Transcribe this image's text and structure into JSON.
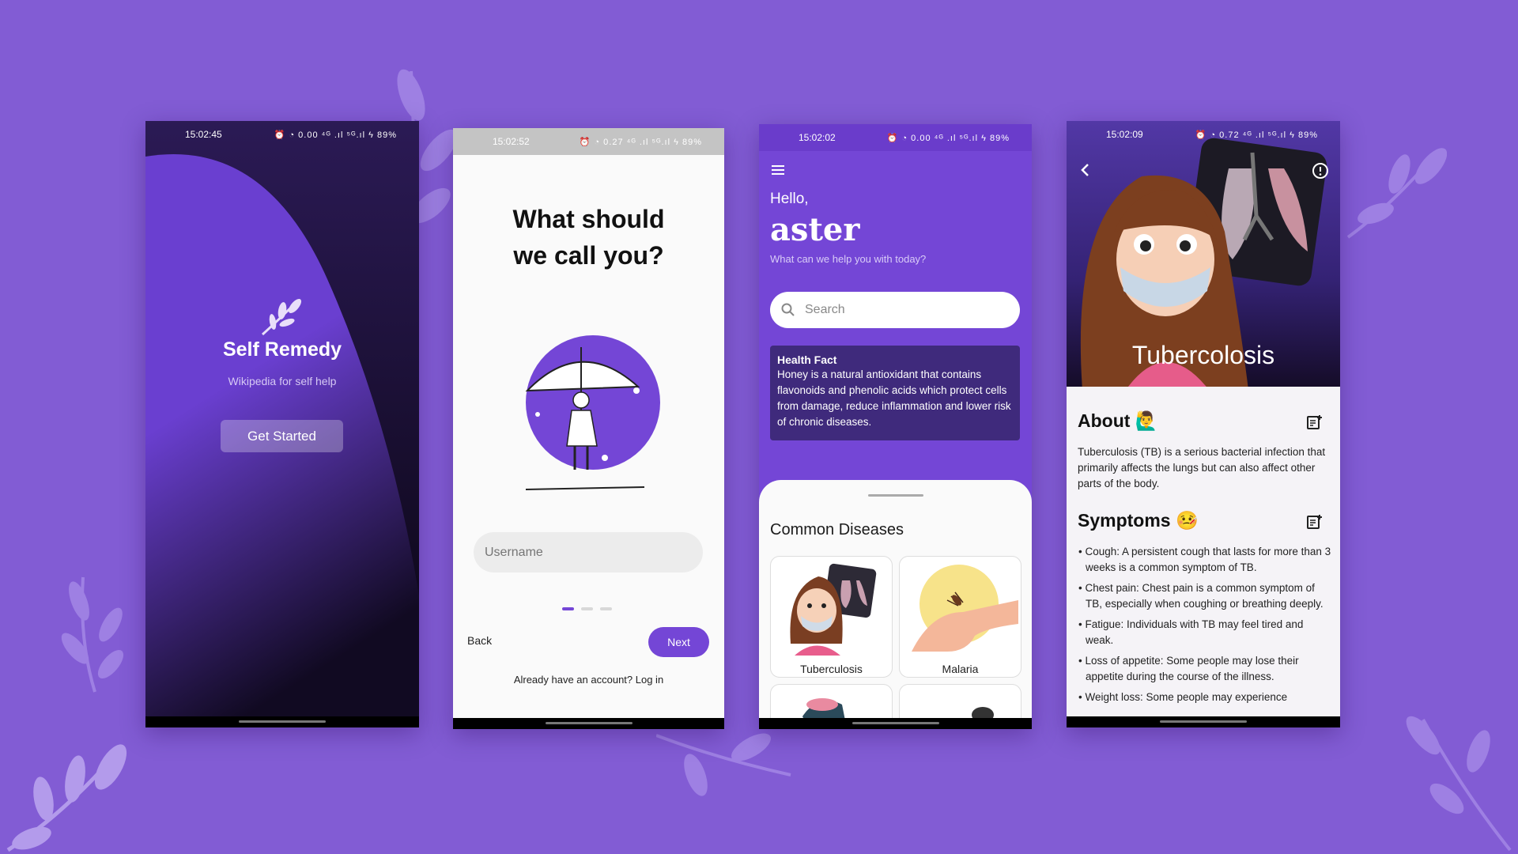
{
  "colors": {
    "background": "#825cd4",
    "accent": "#7446d6",
    "fact_card": "#3f2a7c"
  },
  "splash": {
    "status_time": "15:02:45",
    "status_icons": "⏰ ◔ 0.00 ⁴ᴳ .ıl ⁵ᴳ.ıl ϟ 89%",
    "logo_icon": "leaf-icon",
    "title": "Self Remedy",
    "subtitle": "Wikipedia for self help",
    "button": "Get Started"
  },
  "onboarding": {
    "status_time": "15:02:52",
    "status_icons": "⏰ ◔ 0.27 ⁴ᴳ .ıl ⁵ᴳ.ıl ϟ 89%",
    "question_line1": "What should",
    "question_line2": "we call you?",
    "username_placeholder": "Username",
    "back_label": "Back",
    "next_label": "Next",
    "login_prompt": "Already have an account? Log in",
    "page_indicator": {
      "total": 3,
      "active": 1
    }
  },
  "home": {
    "status_time": "15:02:02",
    "status_icons": "⏰ ◔ 0.00 ⁴ᴳ .ıl ⁵ᴳ.ıl ϟ 89%",
    "greeting": "Hello,",
    "username": "aster",
    "help_question": "What can we help you with today?",
    "search_placeholder": "Search",
    "health_fact": {
      "title": "Health Fact",
      "body": "Honey is a natural antioxidant that contains flavonoids and phenolic acids which protect cells from damage, reduce inflammation and lower risk of chronic diseases."
    },
    "section_title": "Common Diseases",
    "diseases": [
      "Tuberculosis",
      "Malaria"
    ]
  },
  "detail": {
    "status_time": "15:02:09",
    "status_icons": "⏰ ◔ 0.72 ⁴ᴳ .ıl ⁵ᴳ.ıl ϟ 89%",
    "title": "Tubercolosis",
    "about_title": "About 🙋‍♂️",
    "about_text": "Tuberculosis (TB) is a serious bacterial infection that primarily affects the lungs but can also affect other parts of the body.",
    "symptoms_title": "Symptoms 🤒",
    "symptoms": [
      "• Cough: A persistent cough that lasts for more than 3 weeks is a common symptom of TB.",
      "• Chest pain: Chest pain is a common symptom of TB, especially when coughing or breathing deeply.",
      "• Fatigue: Individuals with TB may feel tired and weak.",
      "• Loss of appetite: Some people may lose their appetite during the course of the illness.",
      "• Weight loss: Some people may experience"
    ]
  }
}
